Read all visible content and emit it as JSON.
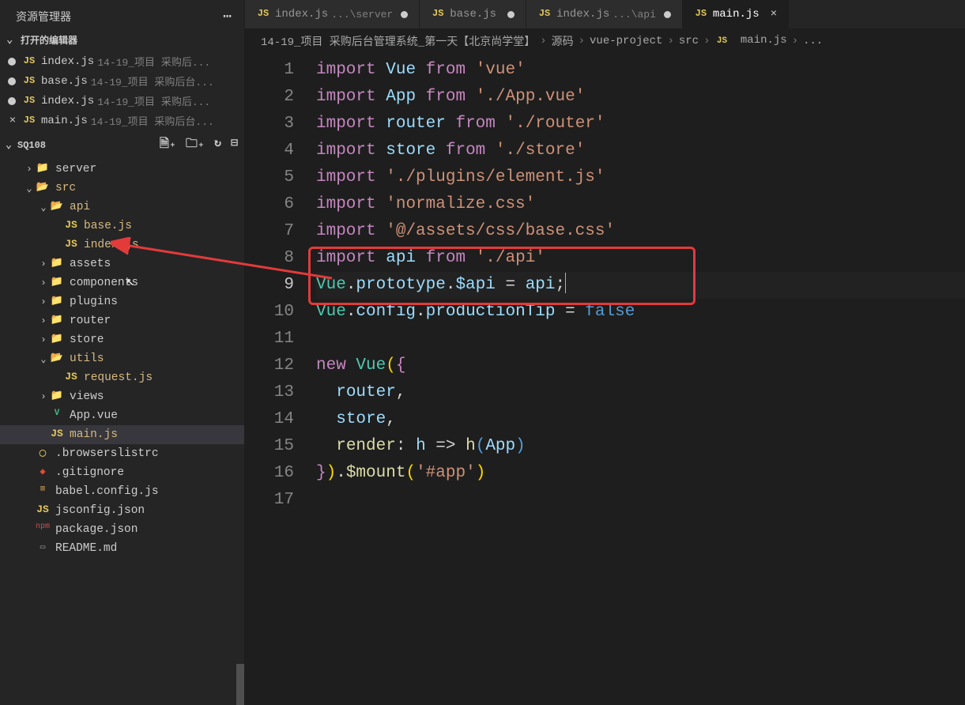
{
  "sidebar": {
    "title": "资源管理器",
    "openEditors": {
      "header": "打开的编辑器",
      "items": [
        {
          "name": "index.js",
          "path": "14-19_项目 采购后...",
          "modified": true
        },
        {
          "name": "base.js",
          "path": "14-19_项目 采购后台...",
          "modified": true
        },
        {
          "name": "index.js",
          "path": "14-19_项目 采购后...",
          "modified": true
        },
        {
          "name": "main.js",
          "path": "14-19_项目 采购后台...",
          "closable": true,
          "active": true
        }
      ]
    },
    "workspace": {
      "name": "SQ108",
      "tree": [
        {
          "type": "folder",
          "name": "server",
          "level": 1,
          "open": false,
          "iconColor": "teal"
        },
        {
          "type": "folder",
          "name": "src",
          "level": 1,
          "open": true,
          "iconColor": "green",
          "modified": true
        },
        {
          "type": "folder",
          "name": "api",
          "level": 2,
          "open": true,
          "iconColor": "green",
          "modified": true
        },
        {
          "type": "file",
          "name": "base.js",
          "level": 3,
          "icon": "js",
          "modified": true
        },
        {
          "type": "file",
          "name": "index.js",
          "level": 3,
          "icon": "js",
          "modified": true
        },
        {
          "type": "folder",
          "name": "assets",
          "level": 2,
          "open": false,
          "iconColor": "orange"
        },
        {
          "type": "folder",
          "name": "components",
          "level": 2,
          "open": false,
          "iconColor": "orange"
        },
        {
          "type": "folder",
          "name": "plugins",
          "level": 2,
          "open": false,
          "iconColor": "orange"
        },
        {
          "type": "folder",
          "name": "router",
          "level": 2,
          "open": false,
          "iconColor": "red"
        },
        {
          "type": "folder",
          "name": "store",
          "level": 2,
          "open": false,
          "iconColor": "orange"
        },
        {
          "type": "folder",
          "name": "utils",
          "level": 2,
          "open": true,
          "iconColor": "green",
          "modified": true
        },
        {
          "type": "file",
          "name": "request.js",
          "level": 3,
          "icon": "js",
          "modified": true
        },
        {
          "type": "folder",
          "name": "views",
          "level": 2,
          "open": false,
          "iconColor": "red"
        },
        {
          "type": "file",
          "name": "App.vue",
          "level": 2,
          "icon": "vue"
        },
        {
          "type": "file",
          "name": "main.js",
          "level": 2,
          "icon": "js",
          "modified": true,
          "selected": true
        },
        {
          "type": "file",
          "name": ".browserslistrc",
          "level": 1,
          "icon": "yellowdot"
        },
        {
          "type": "file",
          "name": ".gitignore",
          "level": 1,
          "icon": "git"
        },
        {
          "type": "file",
          "name": "babel.config.js",
          "level": 1,
          "icon": "babel"
        },
        {
          "type": "file",
          "name": "jsconfig.json",
          "level": 1,
          "icon": "js"
        },
        {
          "type": "file",
          "name": "package.json",
          "level": 1,
          "icon": "pkg"
        },
        {
          "type": "file",
          "name": "README.md",
          "level": 1,
          "icon": "config"
        }
      ]
    }
  },
  "tabs": [
    {
      "label": "index.js",
      "suffix": "...\\server",
      "modified": true
    },
    {
      "label": "base.js",
      "modified": true
    },
    {
      "label": "index.js",
      "suffix": "...\\api",
      "modified": true
    },
    {
      "label": "main.js",
      "active": true,
      "closable": true
    }
  ],
  "breadcrumbs": [
    "14-19_项目 采购后台管理系统_第一天【北京尚学堂】",
    "源码",
    "vue-project",
    "src",
    "main.js",
    "..."
  ],
  "breadcrumb_file_icon": "JS",
  "code": {
    "lines": [
      [
        {
          "t": "kw",
          "v": "import"
        },
        {
          "t": "sp",
          "v": " "
        },
        {
          "t": "var",
          "v": "Vue"
        },
        {
          "t": "sp",
          "v": " "
        },
        {
          "t": "kw",
          "v": "from"
        },
        {
          "t": "sp",
          "v": " "
        },
        {
          "t": "str",
          "v": "'vue'"
        }
      ],
      [
        {
          "t": "kw",
          "v": "import"
        },
        {
          "t": "sp",
          "v": " "
        },
        {
          "t": "var",
          "v": "App"
        },
        {
          "t": "sp",
          "v": " "
        },
        {
          "t": "kw",
          "v": "from"
        },
        {
          "t": "sp",
          "v": " "
        },
        {
          "t": "str",
          "v": "'./App.vue'"
        }
      ],
      [
        {
          "t": "kw",
          "v": "import"
        },
        {
          "t": "sp",
          "v": " "
        },
        {
          "t": "var",
          "v": "router"
        },
        {
          "t": "sp",
          "v": " "
        },
        {
          "t": "kw",
          "v": "from"
        },
        {
          "t": "sp",
          "v": " "
        },
        {
          "t": "str",
          "v": "'./router'"
        }
      ],
      [
        {
          "t": "kw",
          "v": "import"
        },
        {
          "t": "sp",
          "v": " "
        },
        {
          "t": "var",
          "v": "store"
        },
        {
          "t": "sp",
          "v": " "
        },
        {
          "t": "kw",
          "v": "from"
        },
        {
          "t": "sp",
          "v": " "
        },
        {
          "t": "str",
          "v": "'./store'"
        }
      ],
      [
        {
          "t": "kw",
          "v": "import"
        },
        {
          "t": "sp",
          "v": " "
        },
        {
          "t": "str",
          "v": "'./plugins/element.js'"
        }
      ],
      [
        {
          "t": "kw",
          "v": "import"
        },
        {
          "t": "sp",
          "v": " "
        },
        {
          "t": "str",
          "v": "'normalize.css'"
        }
      ],
      [
        {
          "t": "kw",
          "v": "import"
        },
        {
          "t": "sp",
          "v": " "
        },
        {
          "t": "str",
          "v": "'@/assets/css/base.css'"
        }
      ],
      [
        {
          "t": "kw",
          "v": "import"
        },
        {
          "t": "sp",
          "v": " "
        },
        {
          "t": "var",
          "v": "api"
        },
        {
          "t": "sp",
          "v": " "
        },
        {
          "t": "kw",
          "v": "from"
        },
        {
          "t": "sp",
          "v": " "
        },
        {
          "t": "str",
          "v": "'./api'"
        }
      ],
      [
        {
          "t": "class",
          "v": "Vue"
        },
        {
          "t": "op",
          "v": "."
        },
        {
          "t": "var",
          "v": "prototype"
        },
        {
          "t": "op",
          "v": "."
        },
        {
          "t": "var",
          "v": "$api"
        },
        {
          "t": "sp",
          "v": " "
        },
        {
          "t": "op",
          "v": "="
        },
        {
          "t": "sp",
          "v": " "
        },
        {
          "t": "var",
          "v": "api"
        },
        {
          "t": "op",
          "v": ";"
        },
        {
          "t": "cursor",
          "v": ""
        }
      ],
      [
        {
          "t": "class",
          "v": "Vue"
        },
        {
          "t": "op",
          "v": "."
        },
        {
          "t": "var",
          "v": "config"
        },
        {
          "t": "op",
          "v": "."
        },
        {
          "t": "var",
          "v": "productionTip"
        },
        {
          "t": "sp",
          "v": " "
        },
        {
          "t": "op",
          "v": "="
        },
        {
          "t": "sp",
          "v": " "
        },
        {
          "t": "bool",
          "v": "false"
        }
      ],
      [],
      [
        {
          "t": "kw",
          "v": "new"
        },
        {
          "t": "sp",
          "v": " "
        },
        {
          "t": "class",
          "v": "Vue"
        },
        {
          "t": "paren1",
          "v": "("
        },
        {
          "t": "paren2",
          "v": "{"
        }
      ],
      [
        {
          "t": "sp",
          "v": "  "
        },
        {
          "t": "var",
          "v": "router"
        },
        {
          "t": "op",
          "v": ","
        }
      ],
      [
        {
          "t": "sp",
          "v": "  "
        },
        {
          "t": "var",
          "v": "store"
        },
        {
          "t": "op",
          "v": ","
        }
      ],
      [
        {
          "t": "sp",
          "v": "  "
        },
        {
          "t": "func",
          "v": "render"
        },
        {
          "t": "op",
          "v": ":"
        },
        {
          "t": "sp",
          "v": " "
        },
        {
          "t": "var",
          "v": "h"
        },
        {
          "t": "sp",
          "v": " "
        },
        {
          "t": "op",
          "v": "=>"
        },
        {
          "t": "sp",
          "v": " "
        },
        {
          "t": "func",
          "v": "h"
        },
        {
          "t": "paren3",
          "v": "("
        },
        {
          "t": "var",
          "v": "App"
        },
        {
          "t": "paren3",
          "v": ")"
        }
      ],
      [
        {
          "t": "paren2",
          "v": "}"
        },
        {
          "t": "paren1",
          "v": ")"
        },
        {
          "t": "op",
          "v": "."
        },
        {
          "t": "func",
          "v": "$mount"
        },
        {
          "t": "paren1",
          "v": "("
        },
        {
          "t": "str",
          "v": "'#app'"
        },
        {
          "t": "paren1",
          "v": ")"
        }
      ],
      []
    ],
    "highlightStart": 8,
    "highlightEnd": 9
  }
}
